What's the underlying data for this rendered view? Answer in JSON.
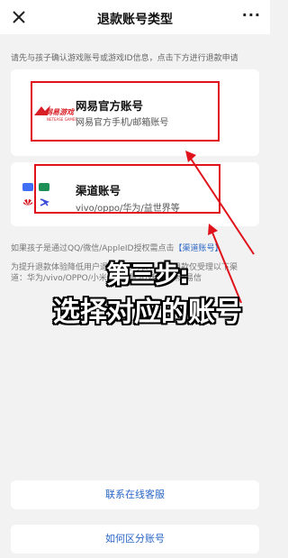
{
  "header": {
    "close_icon": "close-icon",
    "title": "退款账号类型",
    "more_icon": "more-icon"
  },
  "intro_text": "请先与孩子确认游戏账号或游戏ID信息，点击下方进行退款申请",
  "cards": [
    {
      "title": "网易官方账号",
      "subtitle": "网易官方手机/邮箱账号",
      "logo_icon": "netease-games-logo"
    },
    {
      "title": "渠道账号",
      "subtitle": "vivo/oppo/华为/益世界等",
      "logos": [
        "vivo-logo",
        "oppo-logo",
        "huawei-logo",
        "yishijie-logo"
      ]
    }
  ],
  "notes": {
    "line1_prefix": "如果孩子是通过QQ/微信/AppleID授权需点击",
    "line1_link": "【渠道账号】",
    "line2": "为提升退款体验降低用户退款等待时长，渠道退款仅受理以下渠",
    "line3": "道：华为/vivo/OPPO/小米/魅族/酷派/魅族/易畅/易信"
  },
  "overlay": {
    "line1": "第三步:",
    "line2": "选择对应的账号"
  },
  "buttons": {
    "contact": "联系在线客服",
    "distinguish": "如何区分账号"
  },
  "colors": {
    "background": "#f2f2f2",
    "link": "#2a66c7",
    "annotation_red": "#e0121b"
  }
}
